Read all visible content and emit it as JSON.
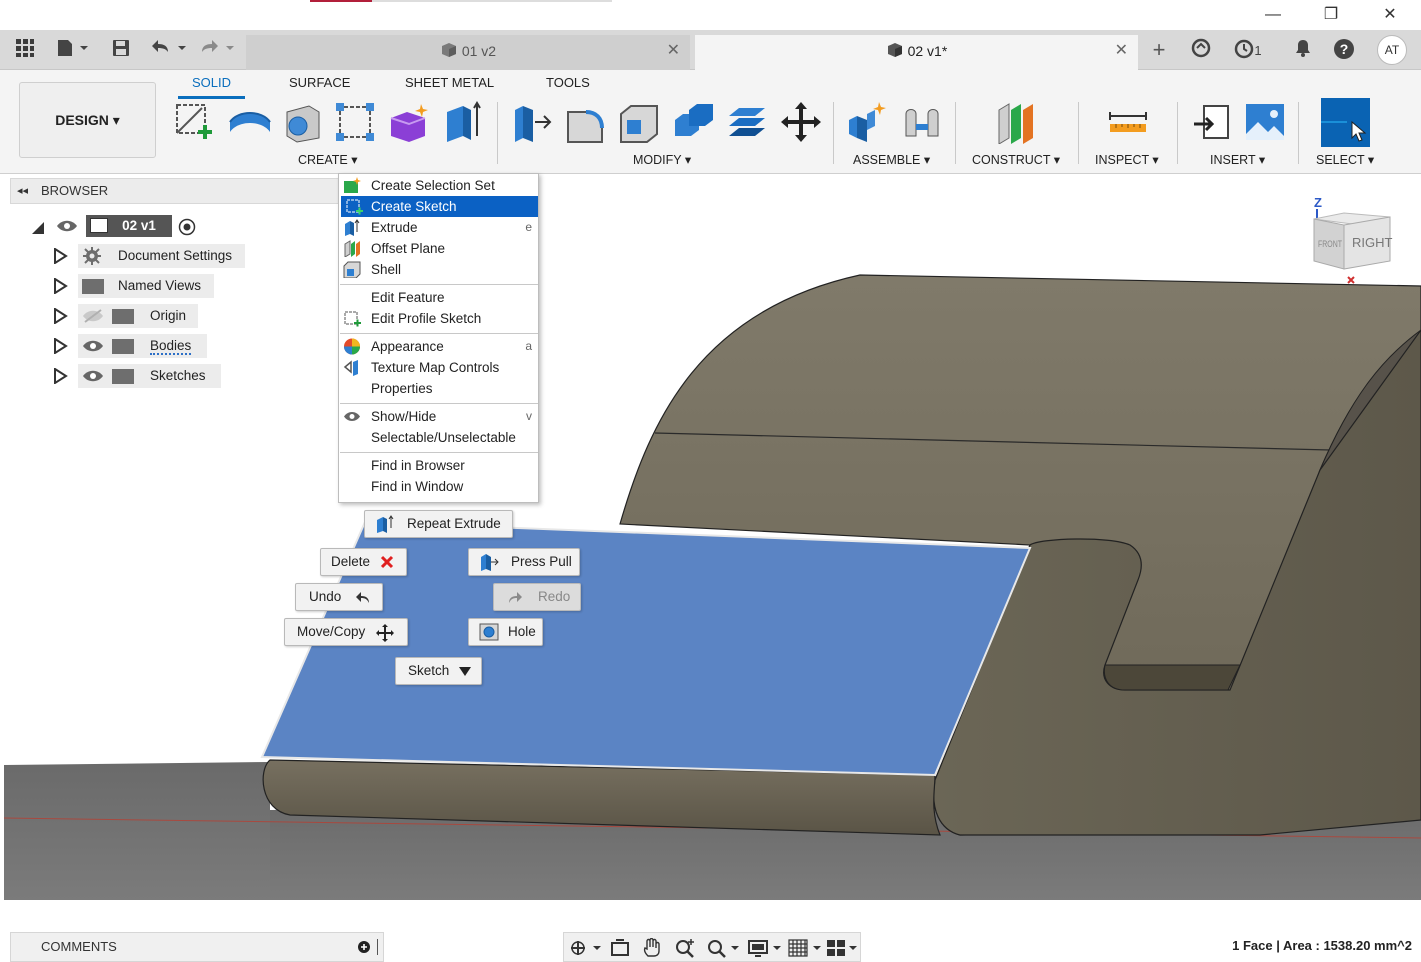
{
  "window": {
    "minimize_label": "—",
    "restore_label": "❐",
    "close_label": "✕"
  },
  "tabs": [
    {
      "label": "01 v2",
      "active": false
    },
    {
      "label": "02 v1*",
      "active": true
    }
  ],
  "tabbar": {
    "job_count": "1",
    "user_initials": "AT",
    "add_tab_label": "+"
  },
  "ribbon": {
    "workspace_label": "DESIGN ▾",
    "tabs": [
      "SOLID",
      "SURFACE",
      "SHEET METAL",
      "TOOLS"
    ],
    "groups": [
      "CREATE ▾",
      "MODIFY ▾",
      "ASSEMBLE ▾",
      "CONSTRUCT ▾",
      "INSPECT ▾",
      "INSERT ▾",
      "SELECT ▾"
    ]
  },
  "browser": {
    "title": "BROWSER",
    "root": "02 v1",
    "nodes": [
      "Document Settings",
      "Named Views",
      "Origin",
      "Bodies",
      "Sketches"
    ]
  },
  "context_menu": {
    "items": [
      {
        "label": "Create Selection Set",
        "shortcut": ""
      },
      {
        "label": "Create Sketch",
        "shortcut": ""
      },
      {
        "label": "Extrude",
        "shortcut": "e"
      },
      {
        "label": "Offset Plane",
        "shortcut": ""
      },
      {
        "label": "Shell",
        "shortcut": ""
      },
      {
        "label": "Edit Feature",
        "shortcut": ""
      },
      {
        "label": "Edit Profile Sketch",
        "shortcut": ""
      },
      {
        "label": "Appearance",
        "shortcut": "a"
      },
      {
        "label": "Texture Map Controls",
        "shortcut": ""
      },
      {
        "label": "Properties",
        "shortcut": ""
      },
      {
        "label": "Show/Hide",
        "shortcut": "v"
      },
      {
        "label": "Selectable/Unselectable",
        "shortcut": ""
      },
      {
        "label": "Find in Browser",
        "shortcut": ""
      },
      {
        "label": "Find in Window",
        "shortcut": ""
      }
    ]
  },
  "marking_menu": {
    "repeat": "Repeat Extrude",
    "delete": "Delete",
    "press_pull": "Press Pull",
    "undo": "Undo",
    "redo": "Redo",
    "move_copy": "Move/Copy",
    "hole": "Hole",
    "sketch": "Sketch"
  },
  "viewcube": {
    "axis": "Z",
    "face_right": "RIGHT",
    "face_front": "FRONT"
  },
  "comments": {
    "label": "COMMENTS"
  },
  "status": {
    "text": "1 Face | Area : 1538.20 mm^2"
  },
  "colors": {
    "accent": "#0a6ebd",
    "selection_face": "#5b84c4",
    "menu_highlight": "#0b61c4",
    "body": "#6b6555"
  }
}
